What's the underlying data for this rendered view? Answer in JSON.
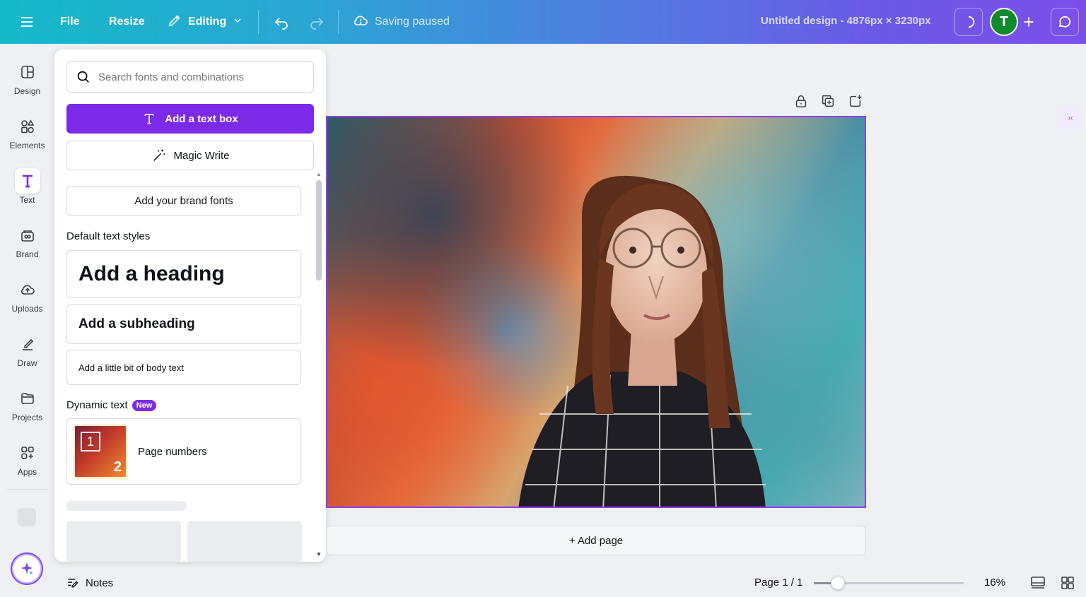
{
  "topbar": {
    "file_label": "File",
    "resize_label": "Resize",
    "editing_label": "Editing",
    "saving_status": "Saving paused",
    "design_title": "Untitled design - 4876px × 3230px",
    "avatar_initial": "T"
  },
  "rail": {
    "items": [
      {
        "label": "Design",
        "icon": "design-icon"
      },
      {
        "label": "Elements",
        "icon": "elements-icon"
      },
      {
        "label": "Text",
        "icon": "text-icon"
      },
      {
        "label": "Brand",
        "icon": "brand-icon"
      },
      {
        "label": "Uploads",
        "icon": "uploads-icon"
      },
      {
        "label": "Draw",
        "icon": "draw-icon"
      },
      {
        "label": "Projects",
        "icon": "projects-icon"
      },
      {
        "label": "Apps",
        "icon": "apps-icon"
      }
    ],
    "active": "Text"
  },
  "panel": {
    "search_placeholder": "Search fonts and combinations",
    "add_text_box": "Add a text box",
    "magic_write": "Magic Write",
    "brand_fonts": "Add your brand fonts",
    "default_styles_title": "Default text styles",
    "heading": "Add a heading",
    "subheading": "Add a subheading",
    "body": "Add a little bit of body text",
    "dynamic_title": "Dynamic text",
    "new_badge": "New",
    "page_numbers": "Page numbers",
    "page_numbers_thumb": {
      "first": "1",
      "second": "2"
    }
  },
  "canvas": {
    "add_page": "+ Add page"
  },
  "footer": {
    "notes": "Notes",
    "page_indicator": "Page 1 / 1",
    "zoom": "16%",
    "zoom_fraction": 0.16
  },
  "colors": {
    "accent": "#7d2ae8",
    "selection": "#8b3dff",
    "avatar": "#118a2e"
  }
}
